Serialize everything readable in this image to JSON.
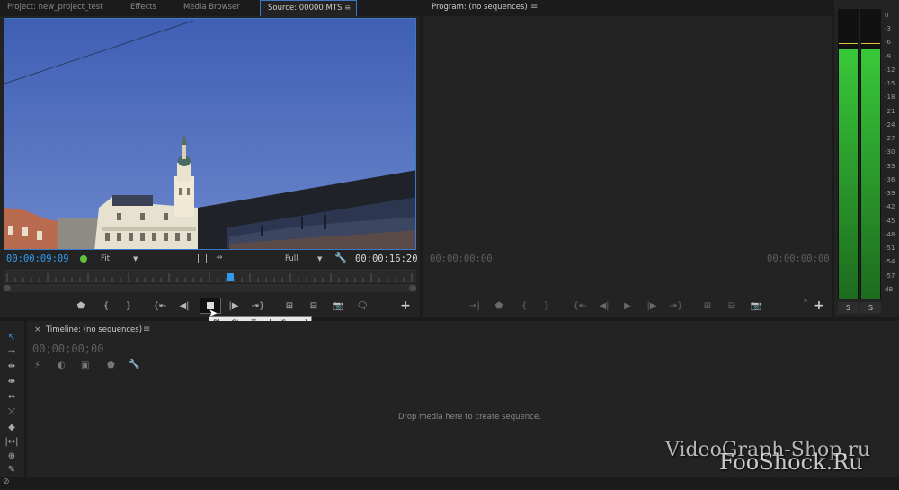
{
  "source_panel": {
    "tabs": [
      {
        "label": "Project: new_project_test"
      },
      {
        "label": "Effects"
      },
      {
        "label": "Media Browser"
      },
      {
        "label": "Source: 00000.MTS"
      }
    ],
    "menu_icon": "≡",
    "current_timecode": "00:00:09:09",
    "zoom_value": "Fit",
    "resolution_value": "Full",
    "duration_timecode": "00:00:16:20"
  },
  "tooltip": {
    "text": "Play-Stop Toggle (Space)"
  },
  "program_panel": {
    "title": "Program: (no sequences)",
    "menu_icon": "≡",
    "current_timecode": "00:00:00:00",
    "duration_timecode": "00:00:00:00"
  },
  "audio_meter": {
    "scale": [
      "0",
      "-3",
      "-6",
      "-9",
      "-12",
      "-15",
      "-18",
      "-21",
      "-24",
      "-27",
      "-30",
      "-33",
      "-36",
      "-39",
      "-42",
      "-45",
      "-48",
      "-51",
      "-54",
      "-57",
      "dB"
    ],
    "solo_labels": [
      "S",
      "S"
    ],
    "levels": {
      "left": 0.86,
      "right": 0.86
    },
    "colors": {
      "top": "#39c83a",
      "bottom": "#1d6b1e",
      "peak": "#e2c23b"
    }
  },
  "timeline_panel": {
    "title": "Timeline: (no sequences)",
    "menu_icon": "≡",
    "timecode": "00;00;00;00",
    "drop_message": "Drop media here to create sequence."
  },
  "watermark": {
    "text1": "VideoGraph-Shop.ru",
    "text2": "FooShock.Ru"
  },
  "colors": {
    "accent": "#2e9bf0",
    "active_border": "#3b78c9",
    "panel_bg": "#232323"
  }
}
